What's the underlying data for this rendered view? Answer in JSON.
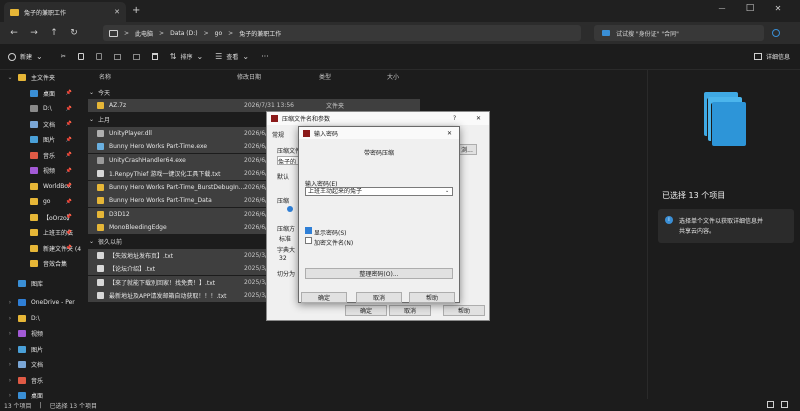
{
  "window": {
    "tab_title": "兔子的兼职工作",
    "new_tab": "+",
    "minimize": "—",
    "maximize": "□",
    "close": "✕"
  },
  "nav": {
    "back": "←",
    "forward": "→",
    "up": "↑",
    "refresh": "↻",
    "breadcrumb": [
      "此电脑",
      "Data (D:)",
      "go",
      "兔子的兼职工作"
    ],
    "breadcrumb_sep": ">",
    "search_placeholder": "试试搜 \"身份证\" \"合同\""
  },
  "toolbar": {
    "new_label": "新建",
    "sort_label": "排序",
    "view_label": "查看",
    "more": "···",
    "details_label": "详细信息"
  },
  "sidebar": {
    "items": [
      {
        "label": "主文件夹",
        "indent": 0,
        "chevron": "⌄",
        "color": "#e6b637",
        "pin": false
      },
      {
        "label": "桌面",
        "indent": 1,
        "chevron": "",
        "color": "#3a8fd6",
        "pin": true
      },
      {
        "label": "D:\\",
        "indent": 1,
        "chevron": "",
        "color": "#8a8a8a",
        "pin": true
      },
      {
        "label": "文档",
        "indent": 1,
        "chevron": "",
        "color": "#7aa6d6",
        "pin": true
      },
      {
        "label": "图片",
        "indent": 1,
        "chevron": "",
        "color": "#4aa0d8",
        "pin": true
      },
      {
        "label": "音乐",
        "indent": 1,
        "chevron": "",
        "color": "#e05a45",
        "pin": true
      },
      {
        "label": "视频",
        "indent": 1,
        "chevron": "",
        "color": "#a35ad6",
        "pin": true
      },
      {
        "label": "WorldBox",
        "indent": 1,
        "chevron": "",
        "color": "#e6b637",
        "pin": true
      },
      {
        "label": "go",
        "indent": 1,
        "chevron": "",
        "color": "#e6b637",
        "pin": true
      },
      {
        "label": "【oOrzo】",
        "indent": 1,
        "chevron": "",
        "color": "#e6b637",
        "pin": true
      },
      {
        "label": "上班王的伝",
        "indent": 1,
        "chevron": "",
        "color": "#e6b637",
        "pin": true
      },
      {
        "label": "新建文件夹 (4",
        "indent": 1,
        "chevron": "",
        "color": "#e6b637",
        "pin": true
      },
      {
        "label": "音效合集",
        "indent": 1,
        "chevron": "",
        "color": "#e6b637",
        "pin": false
      },
      {
        "label": "图库",
        "indent": 0,
        "chevron": "",
        "color": "#3a8fd6",
        "pin": false
      },
      {
        "label": "OneDrive - Per",
        "indent": 0,
        "chevron": "›",
        "color": "#2f7fd6",
        "pin": false
      },
      {
        "label": "D:\\",
        "indent": 0,
        "chevron": "›",
        "color": "#e6b637",
        "pin": false
      },
      {
        "label": "视频",
        "indent": 0,
        "chevron": "›",
        "color": "#a35ad6",
        "pin": false
      },
      {
        "label": "图片",
        "indent": 0,
        "chevron": "›",
        "color": "#4aa0d8",
        "pin": false
      },
      {
        "label": "文档",
        "indent": 0,
        "chevron": "›",
        "color": "#7aa6d6",
        "pin": false
      },
      {
        "label": "音乐",
        "indent": 0,
        "chevron": "›",
        "color": "#e05a45",
        "pin": false
      },
      {
        "label": "桌面",
        "indent": 0,
        "chevron": "›",
        "color": "#3a8fd6",
        "pin": false
      }
    ]
  },
  "columns": {
    "name": "名称",
    "date": "修改日期",
    "type": "类型",
    "size": "大小"
  },
  "groups": {
    "today": "今天",
    "last_month": "上月",
    "long_ago": "很久以前"
  },
  "files": [
    {
      "name": "AZ.7z",
      "date": "2026/7/31 13:56",
      "type": "文件夹",
      "group": "today",
      "color": "#e6b637"
    },
    {
      "name": "UnityPlayer.dll",
      "date": "2026/6/2",
      "type": "",
      "group": "last_month",
      "color": "#b0b0b0"
    },
    {
      "name": "Bunny Hero Works Part-Time.exe",
      "date": "2026/6/2",
      "type": "",
      "group": "last_month",
      "color": "#6ab0e0"
    },
    {
      "name": "UnityCrashHandler64.exe",
      "date": "2026/6/2",
      "type": "",
      "group": "last_month",
      "color": "#9a9a9a"
    },
    {
      "name": "1.RenpyThief 游戏一键汉化工具下载.txt",
      "date": "2026/6/2",
      "type": "",
      "group": "last_month",
      "color": "#d8d8d8"
    },
    {
      "name": "Bunny Hero Works Part-Time_BurstDebugIn...",
      "date": "2026/6/2",
      "type": "",
      "group": "last_month",
      "color": "#e6b637"
    },
    {
      "name": "Bunny Hero Works Part-Time_Data",
      "date": "2026/6/2",
      "type": "",
      "group": "last_month",
      "color": "#e6b637"
    },
    {
      "name": "D3D12",
      "date": "2026/6/2",
      "type": "",
      "group": "last_month",
      "color": "#e6b637"
    },
    {
      "name": "MonoBleedingEdge",
      "date": "2026/6/2",
      "type": "",
      "group": "last_month",
      "color": "#e6b637"
    },
    {
      "name": "【失效地址发布页】.txt",
      "date": "2025/3/2",
      "type": "",
      "group": "long_ago",
      "color": "#d8d8d8"
    },
    {
      "name": "【论坛介绍】.txt",
      "date": "2025/3/2",
      "type": "",
      "group": "long_ago",
      "color": "#d8d8d8"
    },
    {
      "name": "【來了就能下载別回家！找免费！】.txt",
      "date": "2025/3/2",
      "type": "",
      "group": "long_ago",
      "color": "#d8d8d8"
    },
    {
      "name": "最新地址及APP请发邮箱自动获取！！！.txt",
      "date": "2025/3/2",
      "type": "",
      "group": "long_ago",
      "color": "#d8d8d8"
    }
  ],
  "detail_pane": {
    "title": "已选择 13 个项目",
    "info_icon": "i",
    "info_text_1": "选择单个文件以获取详细信息并",
    "info_text_2": "共享云内容。"
  },
  "status": {
    "count": "13 个项目",
    "sep": "|",
    "selected": "已选择 13 个项目"
  },
  "archive_dialog": {
    "title": "压缩文件名和参数",
    "help": "?",
    "close": "✕",
    "tab_general": "常规",
    "lbl_archive_name": "压缩文件",
    "archive_name_value": "兔子的",
    "lbl_default": "默认",
    "lbl_format": "压缩",
    "lbl_update": "压缩方",
    "lbl_update_val": "标准",
    "lbl_split": "字典大",
    "split_val": "32",
    "lbl_split_volumes": "切分为",
    "btn_ok": "确定",
    "btn_cancel": "取消",
    "btn_help": "帮助",
    "browse_btn": "浏..."
  },
  "password_dialog": {
    "title": "输入密码",
    "heading": "带密码压缩",
    "lbl_password": "输入密码(E)",
    "password_value": "上班王动起来的兔子",
    "chk_show": "显示密码(S)",
    "chk_encrypt": "加密文件名(N)",
    "btn_organize": "整理密码(O)...",
    "btn_ok": "确定",
    "btn_cancel": "取消",
    "btn_help": "帮助",
    "close": "✕"
  }
}
